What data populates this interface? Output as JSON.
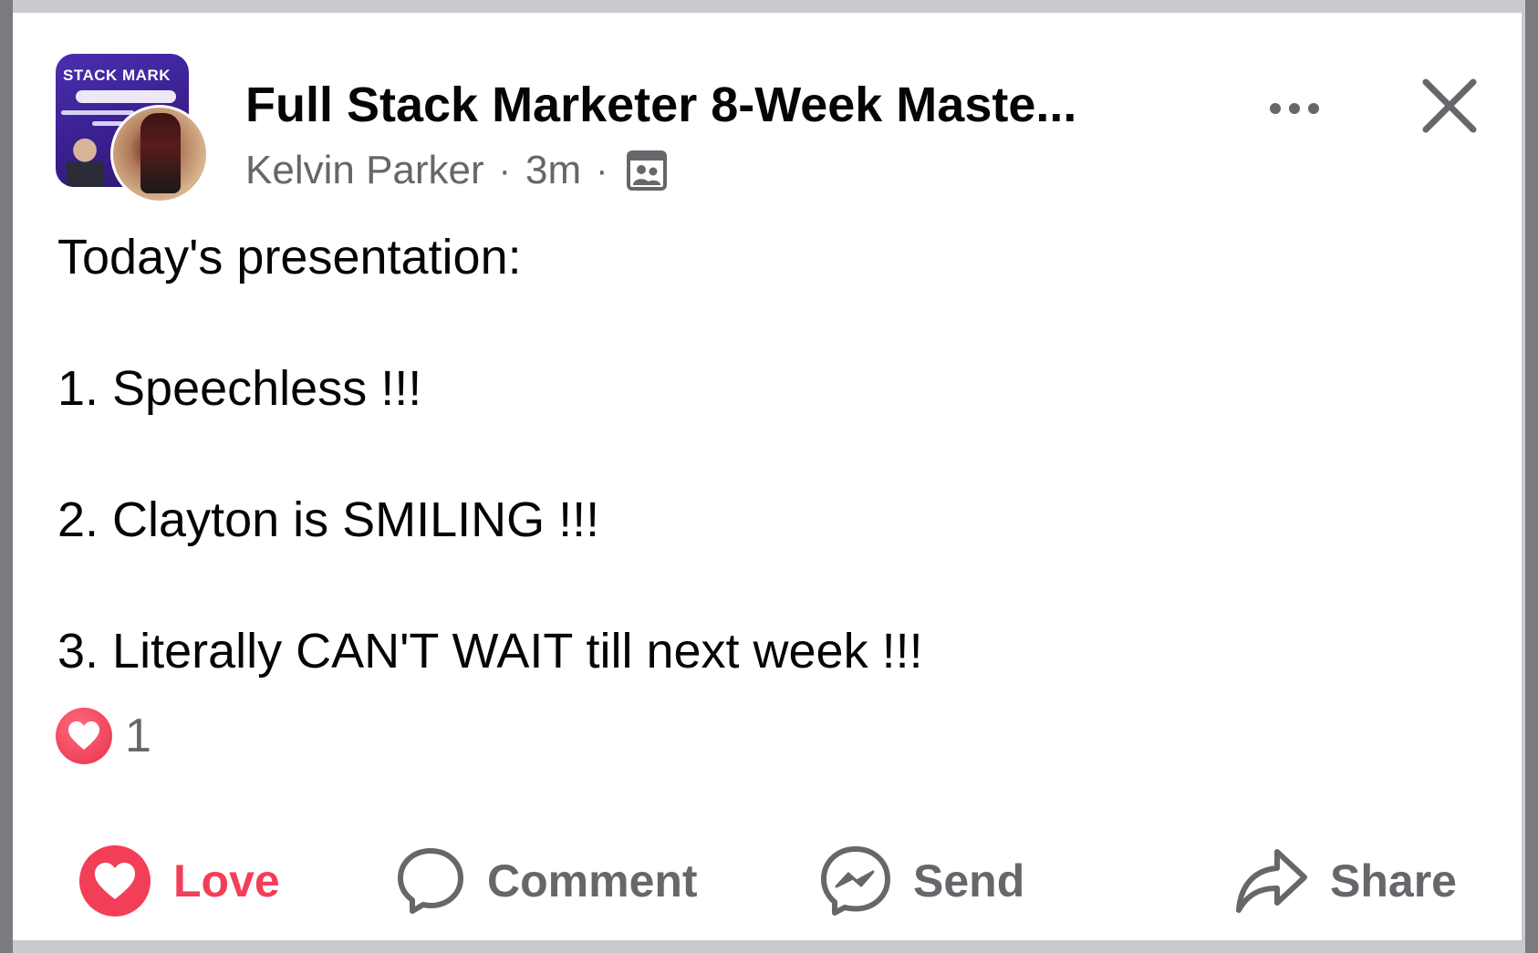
{
  "post": {
    "group_name": "Full Stack Marketer 8-Week Maste...",
    "group_thumb_text": "STACK MARK",
    "author": "Kelvin Parker",
    "time": "3m",
    "privacy_icon": "group-members-icon",
    "body_lines": [
      "Today's presentation:",
      "1. Speechless !!!",
      "2. Clayton is SMILING !!!",
      "3. Literally CAN'T WAIT till next week !!!"
    ],
    "reaction_icon": "love-reaction-icon",
    "reaction_count": "1"
  },
  "actions": {
    "love": "Love",
    "comment": "Comment",
    "send": "Send",
    "share": "Share"
  },
  "colors": {
    "love": "#f33e58",
    "text_primary": "#050505",
    "text_secondary": "#65676b",
    "background": "#ffffff"
  }
}
